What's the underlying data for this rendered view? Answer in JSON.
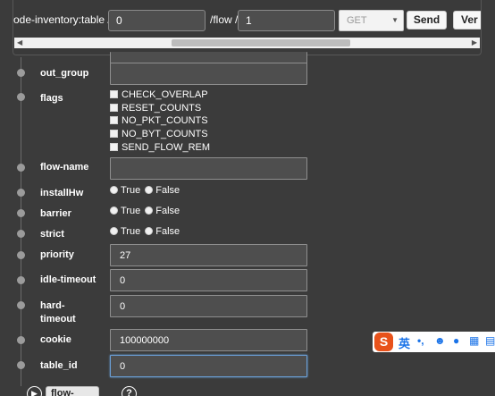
{
  "request_bar": {
    "url_prefix": "ode-inventory:table /",
    "table_value": "0",
    "url_flow": "/flow /",
    "flow_value": "1",
    "method_value": "GET",
    "send_label": "Send",
    "ver_label": "Ver"
  },
  "form": {
    "out_group": {
      "label": "out_group",
      "value": ""
    },
    "flags": {
      "label": "flags",
      "options": [
        "CHECK_OVERLAP",
        "RESET_COUNTS",
        "NO_PKT_COUNTS",
        "NO_BYT_COUNTS",
        "SEND_FLOW_REM"
      ]
    },
    "flow_name": {
      "label": "flow-name",
      "value": ""
    },
    "installHw": {
      "label": "installHw",
      "true_label": "True",
      "false_label": "False"
    },
    "barrier": {
      "label": "barrier",
      "true_label": "True",
      "false_label": "False"
    },
    "strict": {
      "label": "strict",
      "true_label": "True",
      "false_label": "False"
    },
    "priority": {
      "label": "priority",
      "value": "27"
    },
    "idle_timeout": {
      "label": "idle-timeout",
      "value": "0"
    },
    "hard_timeout": {
      "label_line1": "hard-",
      "label_line2": "timeout",
      "value": "0"
    },
    "cookie": {
      "label": "cookie",
      "value": "100000000"
    },
    "table_id": {
      "label": "table_id",
      "value": "0"
    }
  },
  "bottom": {
    "tag_label": "flow-statistics",
    "help_glyph": "?"
  },
  "ime": {
    "logo": "S",
    "mode": "英",
    "punct": "•,",
    "icons": [
      "emoji-icon",
      "microphone-icon",
      "keyboard-icon",
      "menu-icon"
    ]
  }
}
